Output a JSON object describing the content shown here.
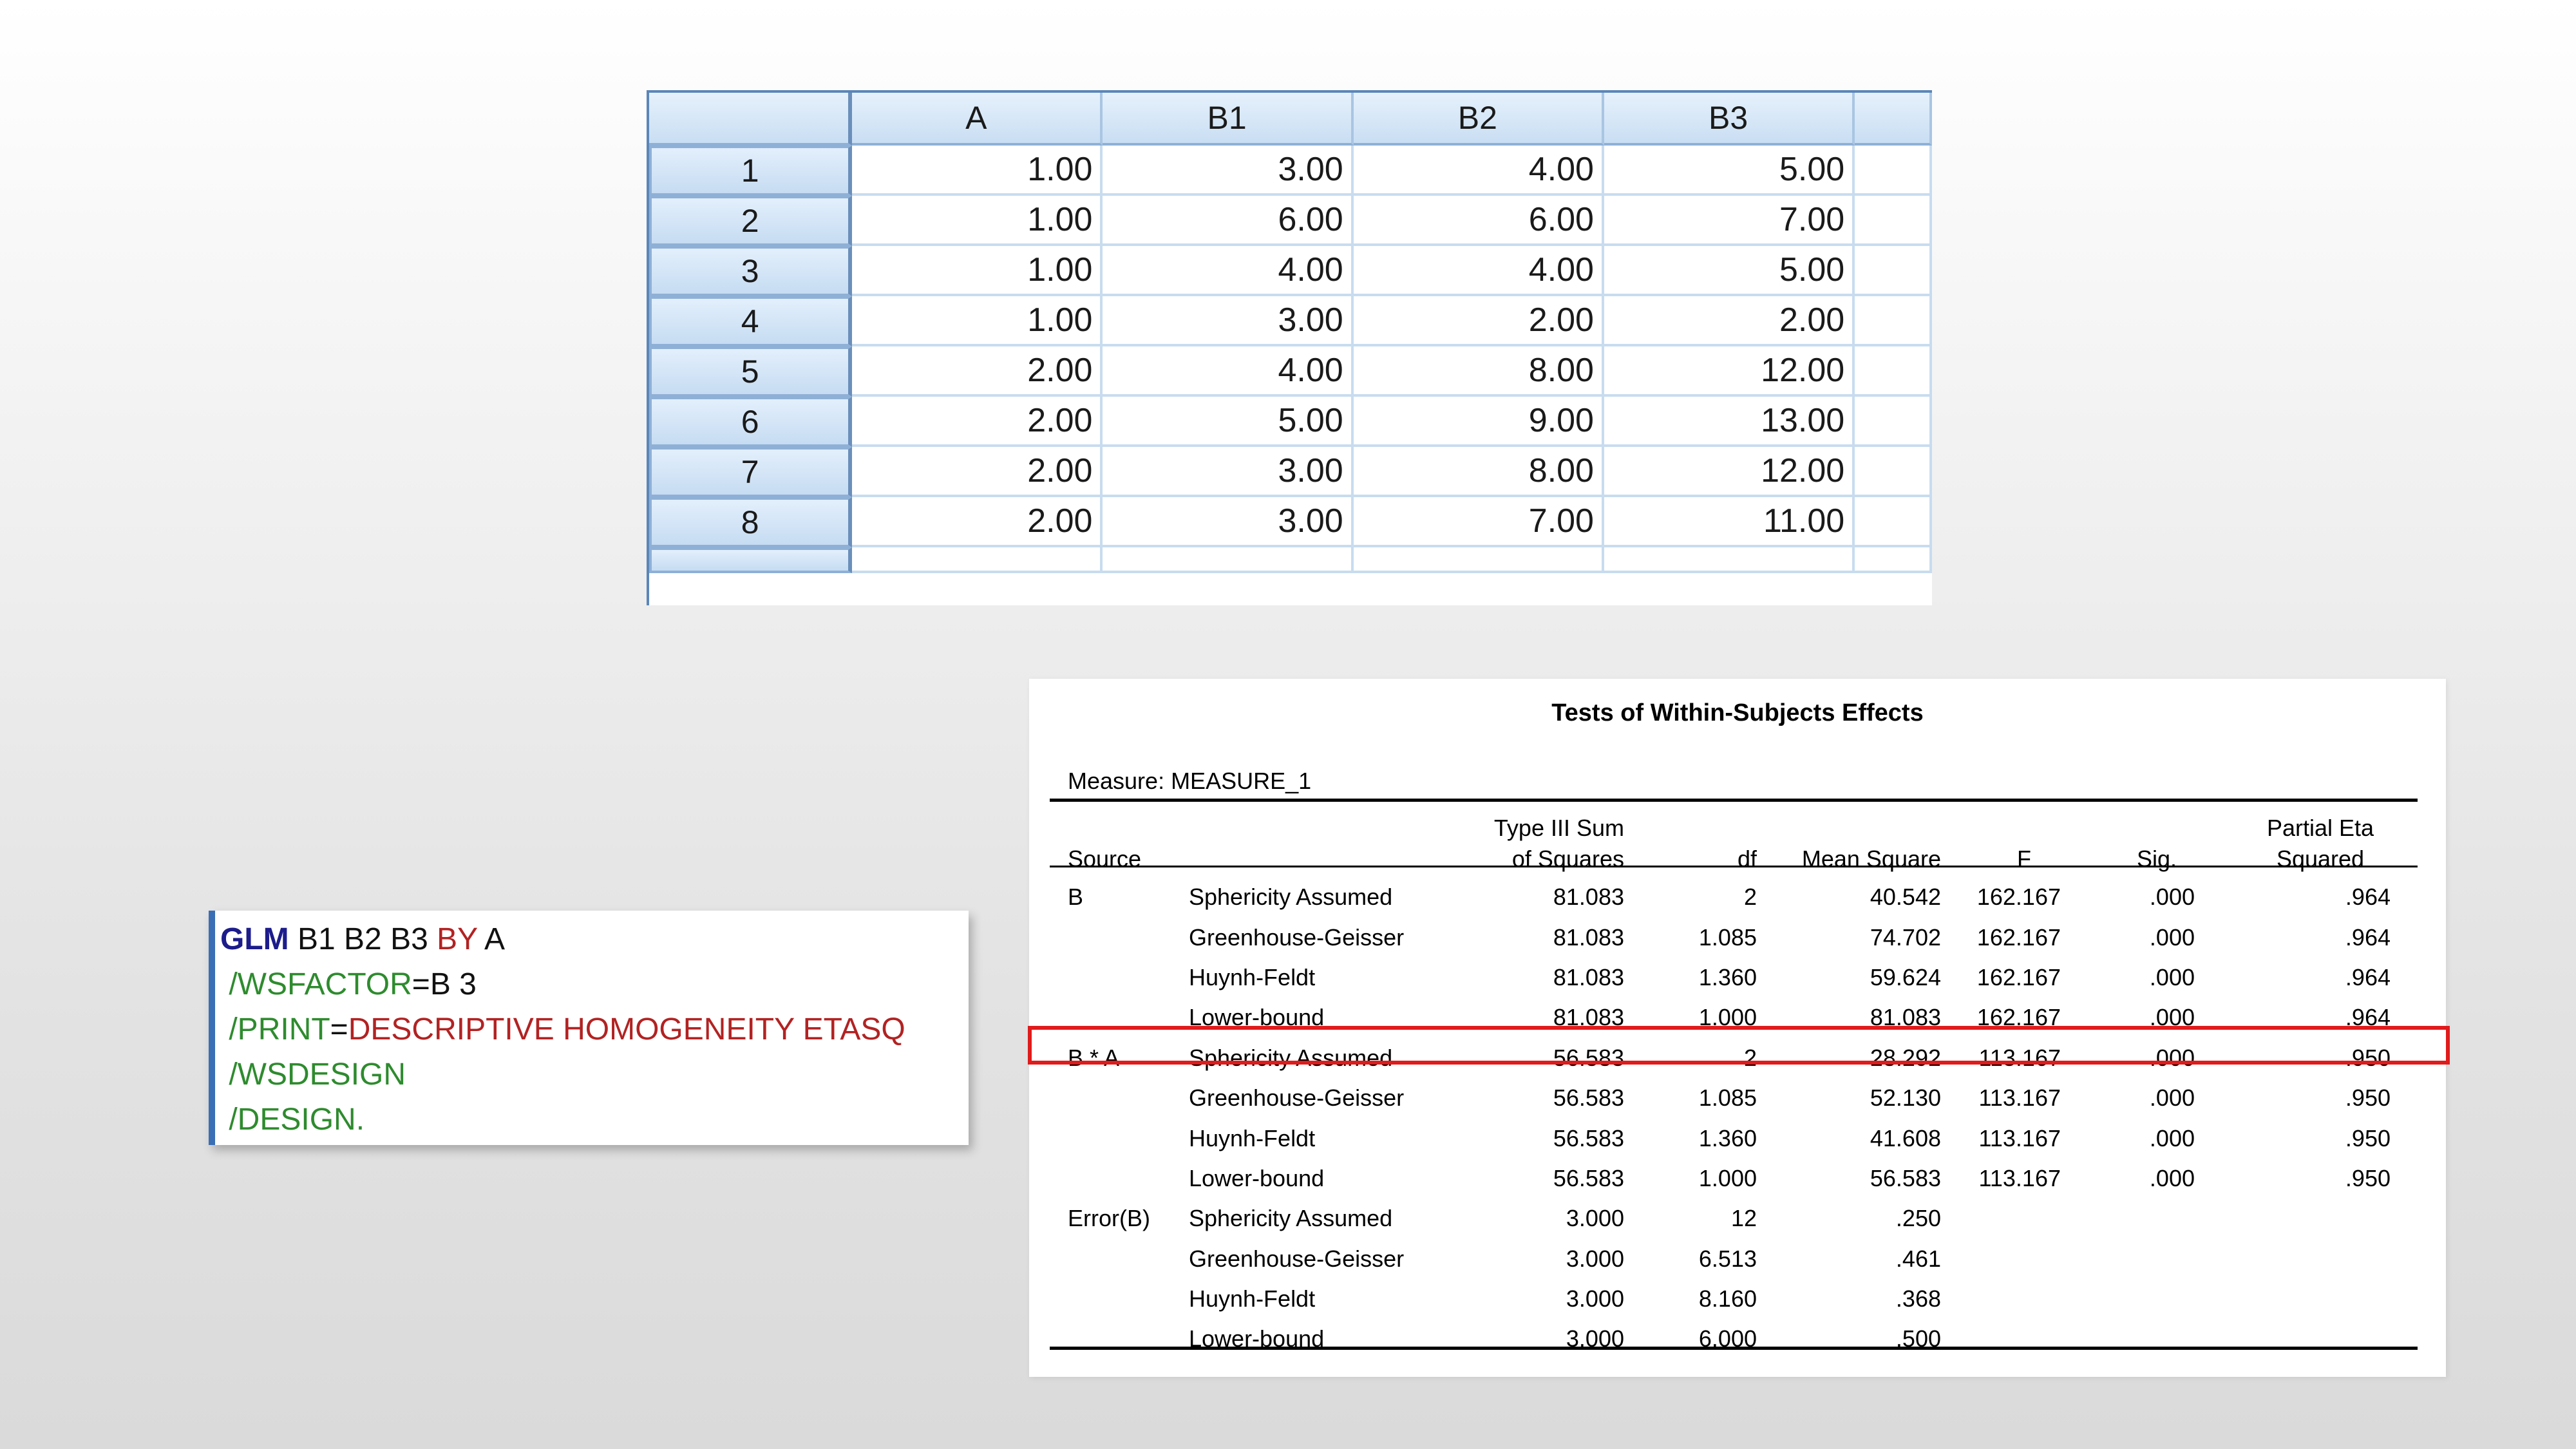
{
  "data_grid": {
    "columns": [
      "A",
      "B1",
      "B2",
      "B3",
      ""
    ],
    "rows": [
      {
        "n": "1",
        "cells": [
          "1.00",
          "3.00",
          "4.00",
          "5.00",
          ""
        ]
      },
      {
        "n": "2",
        "cells": [
          "1.00",
          "6.00",
          "6.00",
          "7.00",
          ""
        ]
      },
      {
        "n": "3",
        "cells": [
          "1.00",
          "4.00",
          "4.00",
          "5.00",
          ""
        ]
      },
      {
        "n": "4",
        "cells": [
          "1.00",
          "3.00",
          "2.00",
          "2.00",
          ""
        ]
      },
      {
        "n": "5",
        "cells": [
          "2.00",
          "4.00",
          "8.00",
          "12.00",
          ""
        ]
      },
      {
        "n": "6",
        "cells": [
          "2.00",
          "5.00",
          "9.00",
          "13.00",
          ""
        ]
      },
      {
        "n": "7",
        "cells": [
          "2.00",
          "3.00",
          "8.00",
          "12.00",
          ""
        ]
      },
      {
        "n": "8",
        "cells": [
          "2.00",
          "3.00",
          "7.00",
          "11.00",
          ""
        ]
      }
    ]
  },
  "syntax": {
    "line1": {
      "cmd": "GLM",
      "vars": " B1 B2 B3 ",
      "by": "BY",
      "factor": " A"
    },
    "line2": {
      "sub": " /WSFACTOR",
      "rest": "=B 3"
    },
    "line3": {
      "sub": " /PRINT",
      "eq": "=",
      "vals": "DESCRIPTIVE HOMOGENEITY ETASQ"
    },
    "line4": {
      "sub": " /WSDESIGN"
    },
    "line5": {
      "sub": " /DESIGN."
    }
  },
  "output": {
    "title": "Tests of Within-Subjects Effects",
    "measure": "Measure: MEASURE_1",
    "headers": {
      "source": "Source",
      "ss_l1": "Type III Sum",
      "ss_l2": "of Squares",
      "df": "df",
      "ms": "Mean Square",
      "f": "F",
      "sig": "Sig.",
      "eta_l1": "Partial Eta",
      "eta_l2": "Squared"
    },
    "rows": [
      {
        "source": "B",
        "correction": "Sphericity Assumed",
        "ss": "81.083",
        "df": "2",
        "ms": "40.542",
        "f": "162.167",
        "sig": ".000",
        "eta": ".964"
      },
      {
        "source": "",
        "correction": "Greenhouse-Geisser",
        "ss": "81.083",
        "df": "1.085",
        "ms": "74.702",
        "f": "162.167",
        "sig": ".000",
        "eta": ".964"
      },
      {
        "source": "",
        "correction": "Huynh-Feldt",
        "ss": "81.083",
        "df": "1.360",
        "ms": "59.624",
        "f": "162.167",
        "sig": ".000",
        "eta": ".964"
      },
      {
        "source": "",
        "correction": "Lower-bound",
        "ss": "81.083",
        "df": "1.000",
        "ms": "81.083",
        "f": "162.167",
        "sig": ".000",
        "eta": ".964"
      },
      {
        "source": "B * A",
        "correction": "Sphericity Assumed",
        "ss": "56.583",
        "df": "2",
        "ms": "28.292",
        "f": "113.167",
        "sig": ".000",
        "eta": ".950"
      },
      {
        "source": "",
        "correction": "Greenhouse-Geisser",
        "ss": "56.583",
        "df": "1.085",
        "ms": "52.130",
        "f": "113.167",
        "sig": ".000",
        "eta": ".950"
      },
      {
        "source": "",
        "correction": "Huynh-Feldt",
        "ss": "56.583",
        "df": "1.360",
        "ms": "41.608",
        "f": "113.167",
        "sig": ".000",
        "eta": ".950"
      },
      {
        "source": "",
        "correction": "Lower-bound",
        "ss": "56.583",
        "df": "1.000",
        "ms": "56.583",
        "f": "113.167",
        "sig": ".000",
        "eta": ".950"
      },
      {
        "source": "Error(B)",
        "correction": "Sphericity Assumed",
        "ss": "3.000",
        "df": "12",
        "ms": ".250",
        "f": "",
        "sig": "",
        "eta": ""
      },
      {
        "source": "",
        "correction": "Greenhouse-Geisser",
        "ss": "3.000",
        "df": "6.513",
        "ms": ".461",
        "f": "",
        "sig": "",
        "eta": ""
      },
      {
        "source": "",
        "correction": "Huynh-Feldt",
        "ss": "3.000",
        "df": "8.160",
        "ms": ".368",
        "f": "",
        "sig": "",
        "eta": ""
      },
      {
        "source": "",
        "correction": "Lower-bound",
        "ss": "3.000",
        "df": "6.000",
        "ms": ".500",
        "f": "",
        "sig": "",
        "eta": ""
      }
    ]
  },
  "colors": {
    "highlight_border": "#e01b1b",
    "syntax_command": "#1c1c8c",
    "syntax_keyword": "#b22222",
    "syntax_subcommand": "#2e8b2e"
  }
}
